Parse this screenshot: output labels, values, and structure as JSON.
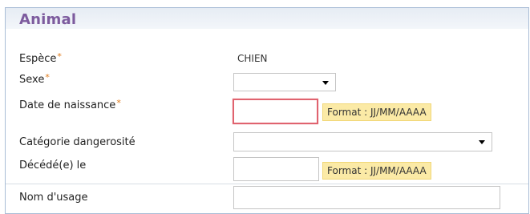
{
  "section": {
    "title": "Animal"
  },
  "fields": {
    "espece": {
      "label": "Espèce",
      "required_marker": "*",
      "value": "CHIEN"
    },
    "sexe": {
      "label": "Sexe",
      "required_marker": "*",
      "selected": ""
    },
    "date_naissance": {
      "label": "Date de naissance",
      "required_marker": "*",
      "value": "",
      "hint": "Format : JJ/MM/AAAA"
    },
    "categorie": {
      "label": "Catégorie dangerosité",
      "selected": ""
    },
    "decede": {
      "label": "Décédé(e) le",
      "value": "",
      "hint": "Format : JJ/MM/AAAA"
    },
    "nom_usage": {
      "label": "Nom d'usage",
      "value": ""
    }
  },
  "colors": {
    "title": "#7d5b9e",
    "required": "#e07b1b",
    "error_border": "#e0636f",
    "hint_background": "#fbeaa6"
  }
}
